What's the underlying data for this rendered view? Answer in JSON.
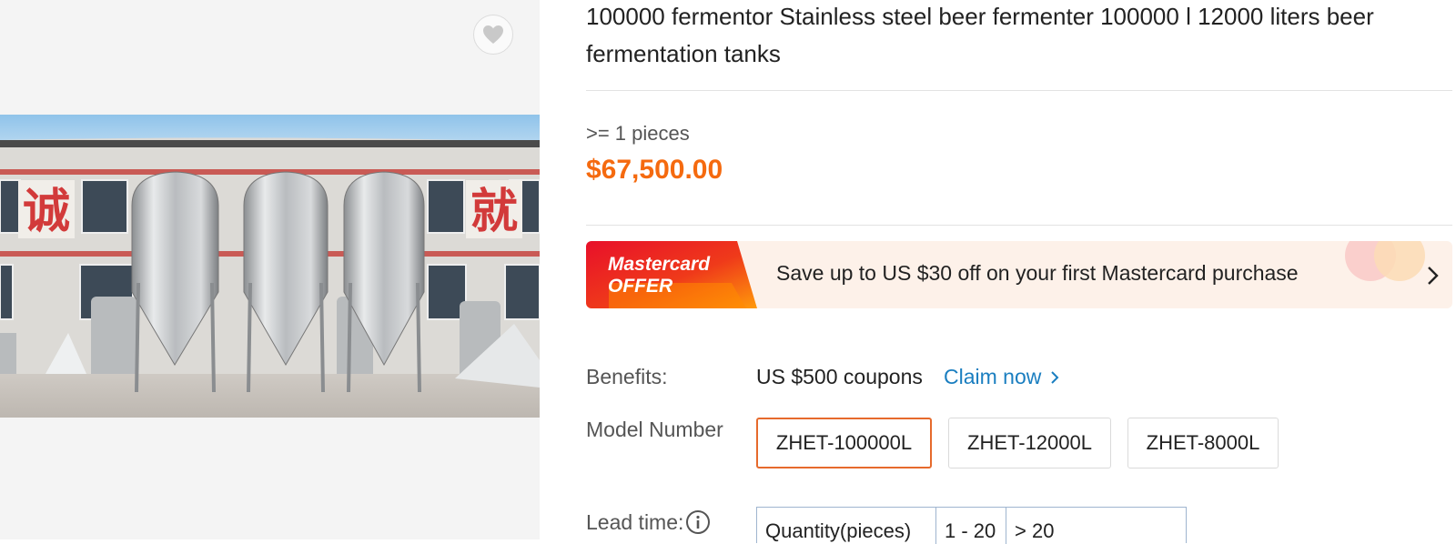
{
  "product": {
    "title": "100000 fermentor Stainless steel beer fermenter 100000 l 12000 liters beer fermentation tanks",
    "photo": {
      "signs": [
        "诚",
        "就"
      ]
    },
    "favorite_icon": "heart-icon"
  },
  "pricing": {
    "min_qty": ">= 1 pieces",
    "price": "$67,500.00",
    "price_color": "#f56a0f"
  },
  "promo": {
    "badge_line1": "Mastercard",
    "badge_line2": "OFFER",
    "text": "Save up to US $30 off on your first Mastercard purchase",
    "chevron_icon": "chevron-right-icon"
  },
  "benefits": {
    "label": "Benefits:",
    "value": "US $500 coupons",
    "link": "Claim now",
    "link_color": "#1a7ec0"
  },
  "model": {
    "label": "Model Number",
    "options": [
      "ZHET-100000L",
      "ZHET-12000L",
      "ZHET-8000L"
    ],
    "selected": "ZHET-100000L"
  },
  "lead_time": {
    "label": "Lead time:",
    "info_icon": "info-icon",
    "cells": [
      "Quantity(pieces)",
      "1 - 20",
      "> 20"
    ]
  }
}
